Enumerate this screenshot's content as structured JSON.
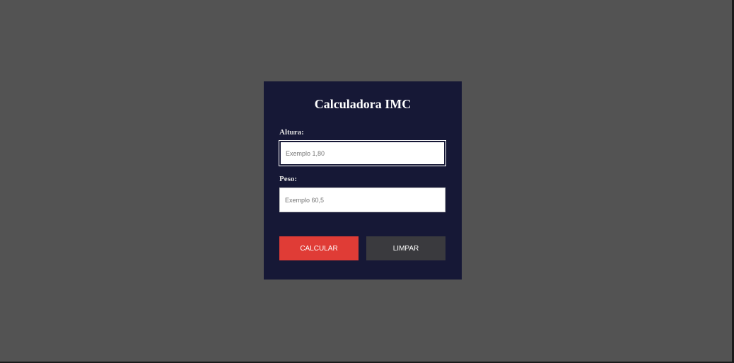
{
  "title": "Calculadora IMC",
  "fields": [
    {
      "label": "Altura:",
      "placeholder": "Exemplo 1,80",
      "value": ""
    },
    {
      "label": "Peso:",
      "placeholder": "Exemplo 60,5",
      "value": ""
    }
  ],
  "buttons": {
    "calculate": "CALCULAR",
    "clear": "LIMPAR"
  }
}
